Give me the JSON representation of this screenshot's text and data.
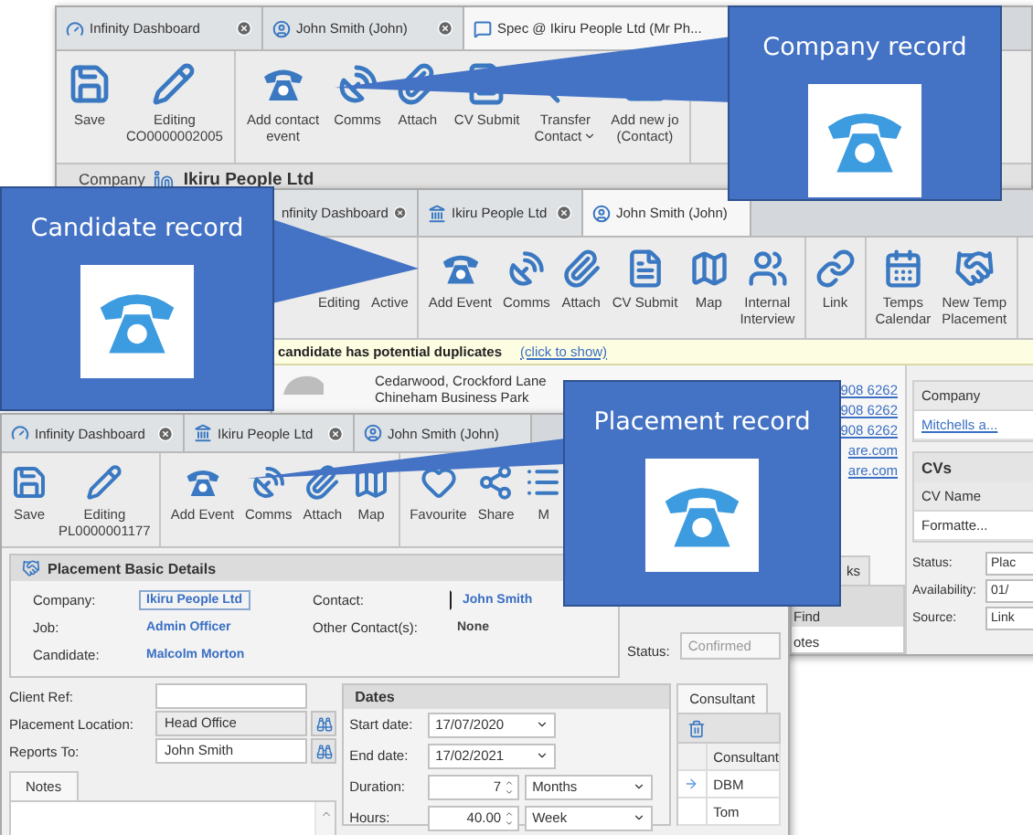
{
  "company_window": {
    "tabs": [
      {
        "label": "Infinity Dashboard",
        "kind": "dashboard",
        "selected": false,
        "closable": true
      },
      {
        "label": "John Smith (John)",
        "kind": "person",
        "selected": false,
        "closable": true
      },
      {
        "label": "Spec @ Ikiru People Ltd (Mr Ph...",
        "kind": "message",
        "selected": true,
        "closable": false
      }
    ],
    "toolbar": [
      [
        {
          "label": "Save",
          "kind": "save"
        },
        {
          "label": "Editing\nCO0000002005",
          "kind": "edit"
        }
      ],
      [
        {
          "label": "Add contact\nevent",
          "kind": "phone"
        },
        {
          "label": "Comms",
          "kind": "comms"
        },
        {
          "label": "Attach",
          "kind": "attach"
        },
        {
          "label": "CV Submit",
          "kind": "cv"
        },
        {
          "label": "Transfer\nContact",
          "kind": "transfer",
          "dropdown": true
        },
        {
          "label": "Add new jo\n(Contact)",
          "kind": "addjob"
        }
      ]
    ],
    "record_bar": {
      "label": "Company",
      "name": "Ikiru People Ltd"
    }
  },
  "candidate_window": {
    "tabs": [
      {
        "label": "nfinity Dashboard",
        "selected": false,
        "closable": true
      },
      {
        "label": "Ikiru People Ltd",
        "kind": "company",
        "selected": false,
        "closable": true
      },
      {
        "label": "John Smith (John)",
        "kind": "person",
        "selected": true,
        "closable": false
      }
    ],
    "toolbar": [
      [
        {
          "label": "Editing"
        },
        {
          "label": "Active"
        }
      ],
      [
        {
          "label": "Add Event",
          "kind": "phone"
        },
        {
          "label": "Comms",
          "kind": "comms"
        },
        {
          "label": "Attach",
          "kind": "attach"
        },
        {
          "label": "CV Submit",
          "kind": "cv"
        },
        {
          "label": "Map",
          "kind": "map"
        },
        {
          "label": "Internal\nInterview",
          "kind": "interview"
        }
      ],
      [
        {
          "label": "Link",
          "kind": "link"
        }
      ],
      [
        {
          "label": "Temps\nCalendar",
          "kind": "calendar"
        },
        {
          "label": "New Temp\nPlacement",
          "kind": "handshake"
        }
      ]
    ],
    "notice": {
      "text": "candidate has potential duplicates",
      "link": "(click to show)"
    },
    "address": [
      "Cedarwood, Crockford Lane",
      "Chineham Business Park"
    ],
    "contact_links": [
      "908 6262",
      "908 6262",
      "908 6262",
      "are.com",
      "are.com"
    ],
    "notes_tab": {
      "label": "ks",
      "items": [
        "Find",
        "otes"
      ]
    },
    "side_panel": {
      "company_header": "Company",
      "company_link": "Mitchells a...",
      "cvs_title": "CVs",
      "cv_column": "CV Name",
      "cv_row": "Formatte...",
      "fields": [
        {
          "label": "Status:",
          "value": "Plac"
        },
        {
          "label": "Availability:",
          "value": "01/"
        },
        {
          "label": "Source:",
          "value": "Link"
        }
      ]
    }
  },
  "placement_window": {
    "tabs": [
      {
        "label": "Infinity Dashboard",
        "kind": "dashboard",
        "selected": false,
        "closable": true
      },
      {
        "label": "Ikiru People Ltd",
        "kind": "company",
        "selected": false,
        "closable": true
      },
      {
        "label": "John Smith (John)",
        "kind": "person",
        "selected": false,
        "closable": false
      }
    ],
    "toolbar": [
      [
        {
          "label": "Save",
          "kind": "save"
        },
        {
          "label": "Editing\nPL0000001177",
          "kind": "edit"
        }
      ],
      [
        {
          "label": "Add Event",
          "kind": "phone"
        },
        {
          "label": "Comms",
          "kind": "comms"
        },
        {
          "label": "Attach",
          "kind": "attach"
        },
        {
          "label": "Map",
          "kind": "map"
        }
      ],
      [
        {
          "label": "Favourite",
          "kind": "favourite"
        },
        {
          "label": "Share",
          "kind": "share"
        },
        {
          "label": "M",
          "kind": "more"
        }
      ]
    ],
    "basic_details": {
      "title": "Placement Basic Details",
      "fields": [
        {
          "label": "Company:",
          "value": "Ikiru People Ltd",
          "kind": "link",
          "focused": true
        },
        {
          "label": "Contact:",
          "value": "John Smith",
          "kind": "link",
          "focused": false
        },
        {
          "label": "Job:",
          "value": "Admin Officer",
          "kind": "link",
          "focused": false
        },
        {
          "label": "Other Contact(s):",
          "value": "None",
          "kind": "plain",
          "focused": false
        },
        {
          "label": "Candidate:",
          "value": "Malcolm Morton",
          "kind": "link",
          "focused": false
        }
      ]
    },
    "status": {
      "label": "Status:",
      "value": "Confirmed",
      "disabled": true
    },
    "form": [
      {
        "label": "Client Ref:",
        "lookup": false,
        "disabled": false
      },
      {
        "label": "Placement Location:",
        "value": "Head Office",
        "lookup": true,
        "disabled": true
      },
      {
        "label": "Reports To:",
        "value": "John Smith",
        "lookup": true,
        "disabled": false
      }
    ],
    "notes_tab": "Notes",
    "dates": {
      "title": "Dates",
      "rows": [
        {
          "label": "Start date:",
          "kind": "date",
          "value": "17/07/2020"
        },
        {
          "label": "End date:",
          "kind": "date",
          "value": "17/02/2021"
        },
        {
          "label": "Duration:",
          "kind": "spin",
          "value": "7",
          "unit": "Months"
        },
        {
          "label": "Hours:",
          "kind": "spin",
          "value": "40.00",
          "unit": "Week"
        }
      ]
    },
    "consultants": {
      "tab": "Consultant",
      "column": "Consultant",
      "rows": [
        {
          "name": "DBM",
          "selected": true
        },
        {
          "name": "Tom",
          "selected": false
        }
      ]
    }
  },
  "callouts": [
    {
      "title": "Company record"
    },
    {
      "title": "Candidate record"
    },
    {
      "title": "Placement record"
    }
  ]
}
